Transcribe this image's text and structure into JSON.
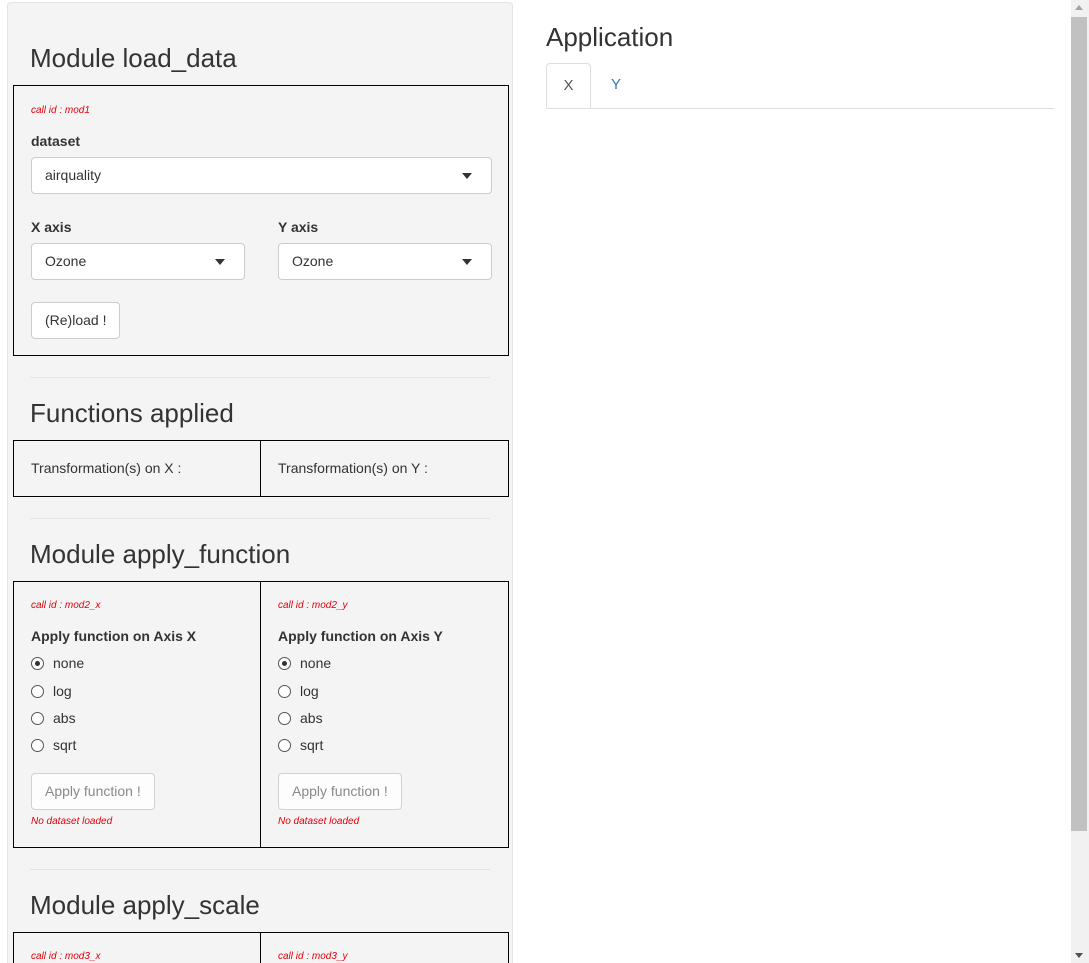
{
  "sidebar": {
    "load_data": {
      "title": "Module load_data",
      "call_id": "call id : mod1",
      "dataset_label": "dataset",
      "dataset_value": "airquality",
      "x_label": "X axis",
      "x_value": "Ozone",
      "y_label": "Y axis",
      "y_value": "Ozone",
      "reload_button": "(Re)load !"
    },
    "functions_applied": {
      "title": "Functions applied",
      "x_text": "Transformation(s) on X :",
      "y_text": "Transformation(s) on Y :"
    },
    "apply_function": {
      "title": "Module apply_function",
      "x": {
        "call_id": "call id : mod2_x",
        "label": "Apply function on Axis X",
        "options": [
          "none",
          "log",
          "abs",
          "sqrt"
        ],
        "selected": "none",
        "button": "Apply function !",
        "status": "No dataset loaded"
      },
      "y": {
        "call_id": "call id : mod2_y",
        "label": "Apply function on Axis Y",
        "options": [
          "none",
          "log",
          "abs",
          "sqrt"
        ],
        "selected": "none",
        "button": "Apply function !",
        "status": "No dataset loaded"
      }
    },
    "apply_scale": {
      "title": "Module apply_scale",
      "x_call_id": "call id : mod3_x",
      "y_call_id": "call id : mod3_y"
    }
  },
  "main": {
    "title": "Application",
    "tabs": [
      {
        "label": "X",
        "active": true
      },
      {
        "label": "Y",
        "active": false
      }
    ]
  },
  "colors": {
    "accent": "#337ab7",
    "call_id_red": "#e0000b",
    "sidebar_bg": "#f4f4f4"
  }
}
